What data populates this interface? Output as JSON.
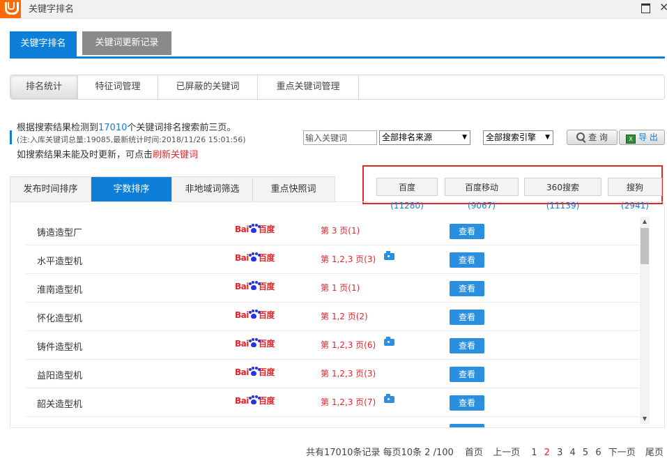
{
  "window": {
    "title": "关键字排名"
  },
  "main_tabs": [
    {
      "label": "关键字排名",
      "active": true
    },
    {
      "label": "关键词更新记录",
      "active": false
    }
  ],
  "sub_tabs": [
    {
      "label": "排名统计",
      "active": true
    },
    {
      "label": "特征词管理",
      "active": false
    },
    {
      "label": "已屏蔽的关键词",
      "active": false
    },
    {
      "label": "重点关键词管理",
      "active": false
    }
  ],
  "info": {
    "line1_prefix": "根据搜索结果检测到",
    "line1_count": "17010",
    "line1_suffix": "个关键词排名搜索前三页。",
    "line2": "(注:入库关键词总量:19085,最新统计时间:2018/11/26 15:01:56)",
    "line3_prefix": "如搜索结果未能及时更新，可点击",
    "refresh_link": "刷新关键词"
  },
  "toolbar": {
    "keyword_placeholder": "输入关键词",
    "source_select": "全部排名来源",
    "engine_select": "全部搜索引擎",
    "query_label": "查 询",
    "export_label": "导 出"
  },
  "sort_tabs": [
    {
      "label": "发布时间排序",
      "active": false
    },
    {
      "label": "字数排序",
      "active": true
    },
    {
      "label": "非地域词筛选",
      "active": false
    },
    {
      "label": "重点快照词",
      "active": false
    }
  ],
  "engine_filters": [
    {
      "name": "百度",
      "count": "(11280)"
    },
    {
      "name": "百度移动",
      "count": "(9067)"
    },
    {
      "name": "360搜索",
      "count": "(11139)"
    },
    {
      "name": "搜狗",
      "count": "(2941)"
    }
  ],
  "logo_text": {
    "bai": "Bai",
    "du": "百度"
  },
  "rows": [
    {
      "keyword": "铸造造型厂",
      "page": "第 3 页(1)",
      "camera": false,
      "action": "查看"
    },
    {
      "keyword": "水平造型机",
      "page": "第 1,2,3 页(3)",
      "camera": true,
      "action": "查看"
    },
    {
      "keyword": "淮南造型机",
      "page": "第 1 页(1)",
      "camera": false,
      "action": "查看"
    },
    {
      "keyword": "怀化造型机",
      "page": "第 1,2 页(2)",
      "camera": false,
      "action": "查看"
    },
    {
      "keyword": "铸件造型机",
      "page": "第 1,2,3 页(6)",
      "camera": true,
      "action": "查看"
    },
    {
      "keyword": "益阳造型机",
      "page": "第 1,2,3 页(3)",
      "camera": false,
      "action": "查看"
    },
    {
      "keyword": "韶关造型机",
      "page": "第 1,2,3 页(7)",
      "camera": true,
      "action": "查看"
    }
  ],
  "pagination": {
    "summary": "共有17010条记录 每页10条 2 /100",
    "first": "首页",
    "prev": "上一页",
    "pages": [
      "1",
      "2",
      "3",
      "4",
      "5",
      "6"
    ],
    "current": "2",
    "next": "下一页",
    "last": "尾页"
  },
  "colors": {
    "accent": "#0e7fd8",
    "highlight_red": "#e2252b",
    "logo_orange": "#fd6a05"
  }
}
